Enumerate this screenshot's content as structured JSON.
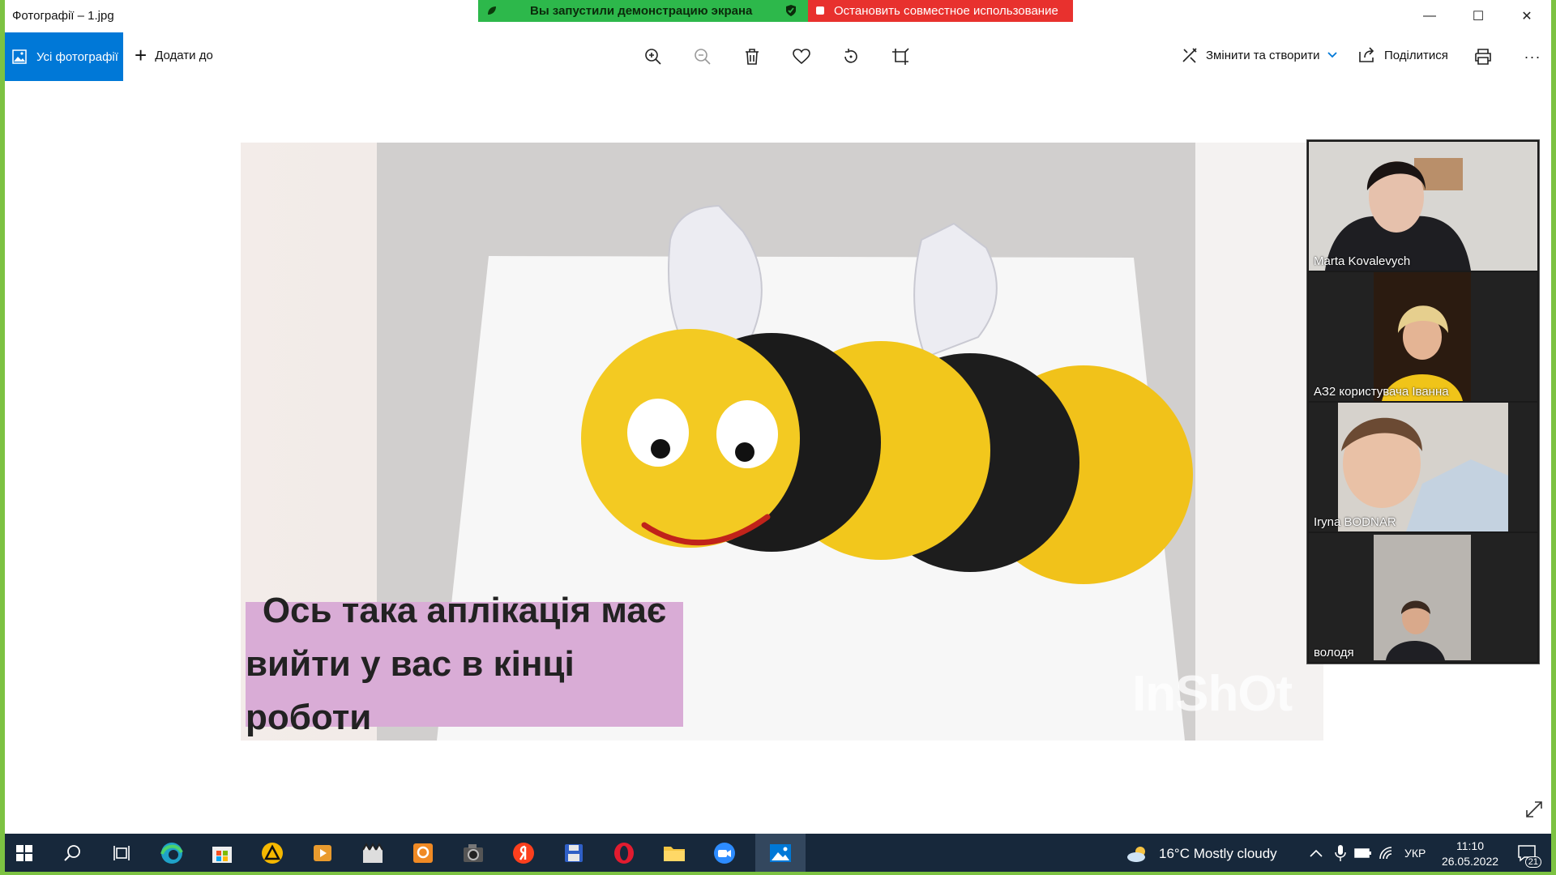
{
  "window": {
    "title": "Фотографії – 1.jpg",
    "controls": {
      "minimize": "—",
      "maximize": "☐",
      "close": "✕"
    }
  },
  "screen_share": {
    "status_text": "Вы запустили демонстрацию экрана",
    "stop_label": "Остановить совместное использование"
  },
  "toolbar": {
    "all_photos_label": "Усі фотографії",
    "add_to_label": "Додати до",
    "edit_create_label": "Змінити та створити",
    "share_label": "Поділитися",
    "more_label": "···"
  },
  "photo": {
    "caption_line1": "Ось така аплікація має",
    "caption_line2": "вийти у вас в кінці роботи",
    "watermark": "InShOt"
  },
  "participants": [
    {
      "name": "Marta Kovalevych"
    },
    {
      "name": "АЗ2 користувача Іванна"
    },
    {
      "name": "Iryna BODNAR"
    },
    {
      "name": "володя"
    }
  ],
  "taskbar": {
    "weather": "16°C  Mostly cloudy",
    "language": "УКР",
    "time": "11:10",
    "date": "26.05.2022",
    "notifications": "21"
  },
  "colors": {
    "accent": "#0078d7",
    "share_green": "#2db84b",
    "share_red": "#e8312e",
    "taskbar": "#17283b",
    "bee_yellow": "#f2c81b",
    "bee_black": "#1b1b1b"
  }
}
